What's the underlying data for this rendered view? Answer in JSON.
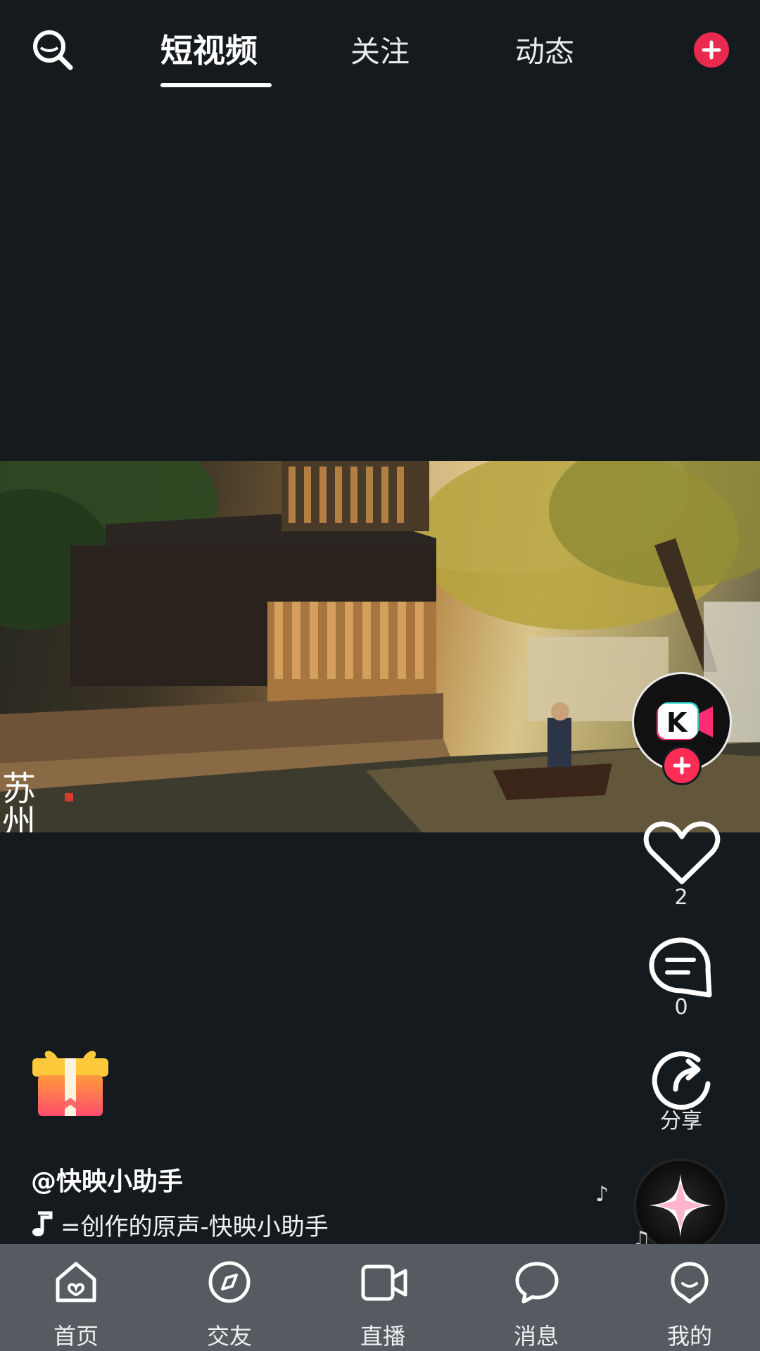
{
  "top_bar": {
    "tabs": [
      {
        "label": "短视频",
        "active": true
      },
      {
        "label": "关注",
        "active": false
      },
      {
        "label": "动态",
        "active": false
      }
    ],
    "search_icon": "search-icon",
    "plus_icon": "plus-icon"
  },
  "video": {
    "watermark_text": "苏州"
  },
  "side_rail": {
    "avatar_icon": "kuaiying-logo-icon",
    "like_count": "2",
    "comment_count": "0",
    "share_label": "分享"
  },
  "caption": {
    "author": "@快映小助手",
    "music": "=创作的原声-快映小助手"
  },
  "bottom_nav": {
    "items": [
      {
        "label": "首页",
        "icon": "home-icon",
        "active": true
      },
      {
        "label": "交友",
        "icon": "compass-icon",
        "active": false
      },
      {
        "label": "直播",
        "icon": "video-camera-icon",
        "active": false
      },
      {
        "label": "消息",
        "icon": "chat-bubble-icon",
        "active": false
      },
      {
        "label": "我的",
        "icon": "profile-icon",
        "active": false
      }
    ]
  },
  "colors": {
    "background": "#151a1f",
    "accent": "#e9294e",
    "nav_background": "#565b61"
  }
}
